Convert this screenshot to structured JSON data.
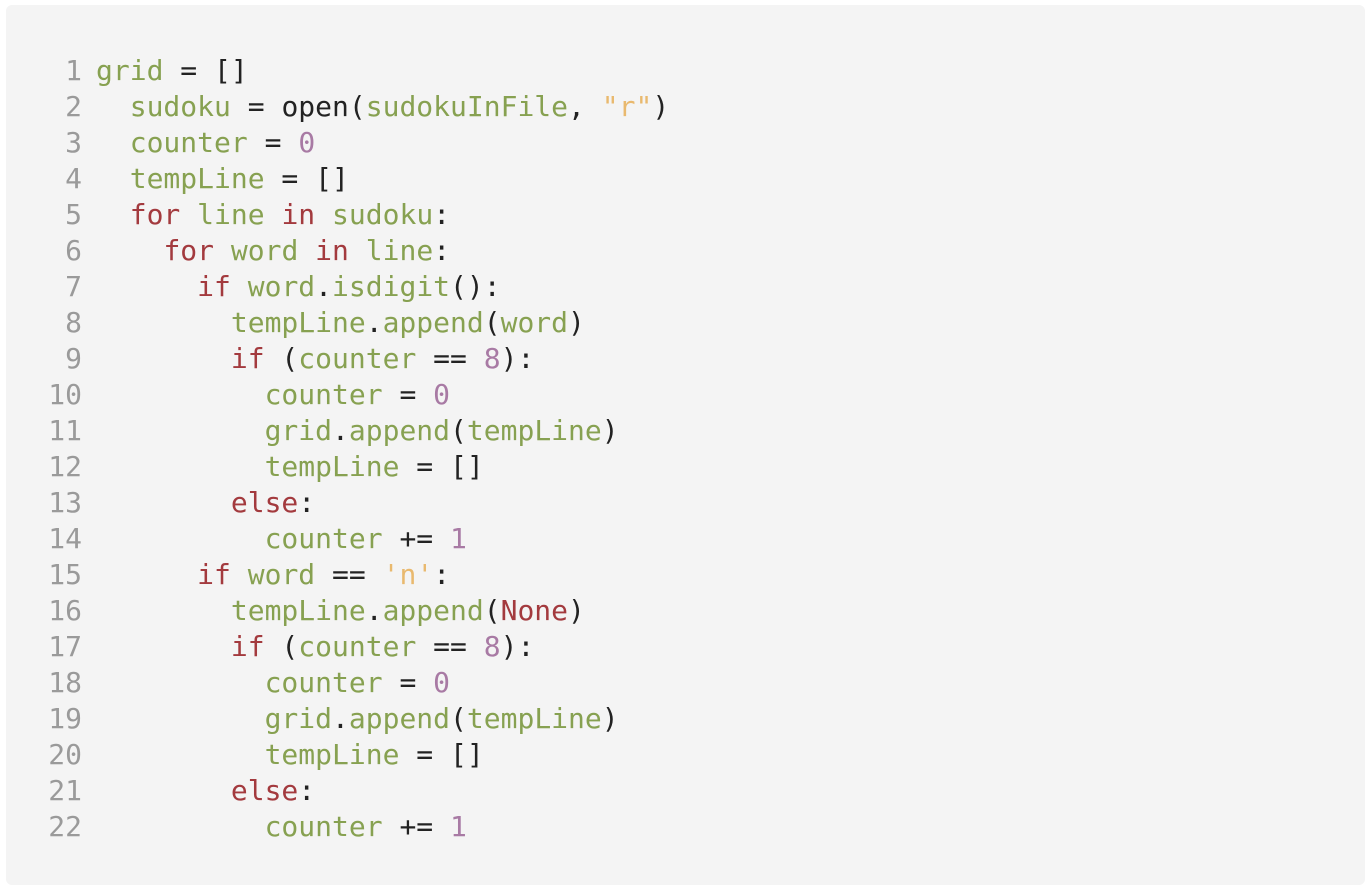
{
  "colors": {
    "panel_bg": "#f4f4f4",
    "line_number": "#9a9a9a",
    "variable": "#87a151",
    "keyword": "#a33a3e",
    "number": "#a87aa4",
    "string": "#e9b96e",
    "default": "#222222"
  },
  "lines": [
    {
      "num": "1",
      "indent": 0,
      "tokens": [
        [
          "grid",
          "var"
        ],
        [
          " = []",
          "op"
        ]
      ]
    },
    {
      "num": "2",
      "indent": 1,
      "tokens": [
        [
          "sudoku",
          "var"
        ],
        [
          " = open(",
          "op"
        ],
        [
          "sudokuInFile",
          "var"
        ],
        [
          ", ",
          "op"
        ],
        [
          "\"r\"",
          "str"
        ],
        [
          ")",
          "op"
        ]
      ]
    },
    {
      "num": "3",
      "indent": 1,
      "tokens": [
        [
          "counter",
          "var"
        ],
        [
          " = ",
          "op"
        ],
        [
          "0",
          "num"
        ]
      ]
    },
    {
      "num": "4",
      "indent": 1,
      "tokens": [
        [
          "tempLine",
          "var"
        ],
        [
          " = []",
          "op"
        ]
      ]
    },
    {
      "num": "5",
      "indent": 1,
      "tokens": [
        [
          "for",
          "kw"
        ],
        [
          " ",
          "op"
        ],
        [
          "line",
          "var"
        ],
        [
          " ",
          "op"
        ],
        [
          "in",
          "kw"
        ],
        [
          " ",
          "op"
        ],
        [
          "sudoku",
          "var"
        ],
        [
          ":",
          "op"
        ]
      ]
    },
    {
      "num": "6",
      "indent": 2,
      "tokens": [
        [
          "for",
          "kw"
        ],
        [
          " ",
          "op"
        ],
        [
          "word",
          "var"
        ],
        [
          " ",
          "op"
        ],
        [
          "in",
          "kw"
        ],
        [
          " ",
          "op"
        ],
        [
          "line",
          "var"
        ],
        [
          ":",
          "op"
        ]
      ]
    },
    {
      "num": "7",
      "indent": 3,
      "tokens": [
        [
          "if",
          "kw"
        ],
        [
          " ",
          "op"
        ],
        [
          "word",
          "var"
        ],
        [
          ".",
          "op"
        ],
        [
          "isdigit",
          "var"
        ],
        [
          "():",
          "op"
        ]
      ]
    },
    {
      "num": "8",
      "indent": 4,
      "tokens": [
        [
          "tempLine",
          "var"
        ],
        [
          ".",
          "op"
        ],
        [
          "append",
          "var"
        ],
        [
          "(",
          "op"
        ],
        [
          "word",
          "var"
        ],
        [
          ")",
          "op"
        ]
      ]
    },
    {
      "num": "9",
      "indent": 4,
      "tokens": [
        [
          "if",
          "kw"
        ],
        [
          " (",
          "op"
        ],
        [
          "counter",
          "var"
        ],
        [
          " == ",
          "op"
        ],
        [
          "8",
          "num"
        ],
        [
          "):",
          "op"
        ]
      ]
    },
    {
      "num": "10",
      "indent": 5,
      "tokens": [
        [
          "counter",
          "var"
        ],
        [
          " = ",
          "op"
        ],
        [
          "0",
          "num"
        ]
      ]
    },
    {
      "num": "11",
      "indent": 5,
      "tokens": [
        [
          "grid",
          "var"
        ],
        [
          ".",
          "op"
        ],
        [
          "append",
          "var"
        ],
        [
          "(",
          "op"
        ],
        [
          "tempLine",
          "var"
        ],
        [
          ")",
          "op"
        ]
      ]
    },
    {
      "num": "12",
      "indent": 5,
      "tokens": [
        [
          "tempLine",
          "var"
        ],
        [
          " = []",
          "op"
        ]
      ]
    },
    {
      "num": "13",
      "indent": 4,
      "tokens": [
        [
          "else",
          "kw"
        ],
        [
          ":",
          "op"
        ]
      ]
    },
    {
      "num": "14",
      "indent": 5,
      "tokens": [
        [
          "counter",
          "var"
        ],
        [
          " += ",
          "op"
        ],
        [
          "1",
          "num"
        ]
      ]
    },
    {
      "num": "15",
      "indent": 3,
      "tokens": [
        [
          "if",
          "kw"
        ],
        [
          " ",
          "op"
        ],
        [
          "word",
          "var"
        ],
        [
          " == ",
          "op"
        ],
        [
          "'n'",
          "str"
        ],
        [
          ":",
          "op"
        ]
      ]
    },
    {
      "num": "16",
      "indent": 4,
      "tokens": [
        [
          "tempLine",
          "var"
        ],
        [
          ".",
          "op"
        ],
        [
          "append",
          "var"
        ],
        [
          "(",
          "op"
        ],
        [
          "None",
          "kw"
        ],
        [
          ")",
          "op"
        ]
      ]
    },
    {
      "num": "17",
      "indent": 4,
      "tokens": [
        [
          "if",
          "kw"
        ],
        [
          " (",
          "op"
        ],
        [
          "counter",
          "var"
        ],
        [
          " == ",
          "op"
        ],
        [
          "8",
          "num"
        ],
        [
          "):",
          "op"
        ]
      ]
    },
    {
      "num": "18",
      "indent": 5,
      "tokens": [
        [
          "counter",
          "var"
        ],
        [
          " = ",
          "op"
        ],
        [
          "0",
          "num"
        ]
      ]
    },
    {
      "num": "19",
      "indent": 5,
      "tokens": [
        [
          "grid",
          "var"
        ],
        [
          ".",
          "op"
        ],
        [
          "append",
          "var"
        ],
        [
          "(",
          "op"
        ],
        [
          "tempLine",
          "var"
        ],
        [
          ")",
          "op"
        ]
      ]
    },
    {
      "num": "20",
      "indent": 5,
      "tokens": [
        [
          "tempLine",
          "var"
        ],
        [
          " = []",
          "op"
        ]
      ]
    },
    {
      "num": "21",
      "indent": 4,
      "tokens": [
        [
          "else",
          "kw"
        ],
        [
          ":",
          "op"
        ]
      ]
    },
    {
      "num": "22",
      "indent": 5,
      "tokens": [
        [
          "counter",
          "var"
        ],
        [
          " += ",
          "op"
        ],
        [
          "1",
          "num"
        ]
      ]
    }
  ]
}
